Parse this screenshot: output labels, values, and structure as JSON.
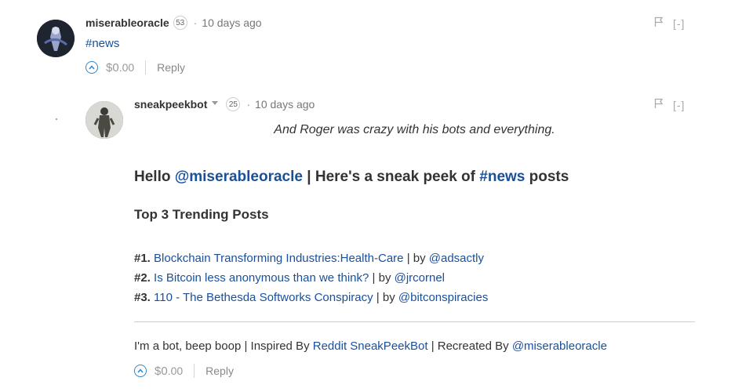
{
  "comment1": {
    "author": "miserableoracle",
    "reputation": "53",
    "time": "10 days ago",
    "body_tag": "#news",
    "payout_whole": "$0",
    "payout_decimal": ".00",
    "reply_label": "Reply",
    "collapse_label": "[-]",
    "icons": {
      "flag": "flag-icon",
      "vote": "upvote-icon"
    }
  },
  "comment2": {
    "author": "sneakpeekbot",
    "reputation": "25",
    "time": "10 days ago",
    "quote": "And Roger was crazy with his bots and everything.",
    "heading": {
      "hello": "Hello",
      "mention": "@miserableoracle",
      "middle": "| Here's a sneak peek of",
      "tag": "#news",
      "end": "posts"
    },
    "subheading": "Top 3 Trending Posts",
    "posts": [
      {
        "num": "#1.",
        "title": "Blockchain Transforming Industries:Health-Care",
        "by": "| by",
        "author": "@adsactly"
      },
      {
        "num": "#2.",
        "title": "Is Bitcoin less anonymous than we think?",
        "by": "| by",
        "author": "@jrcornel"
      },
      {
        "num": "#3.",
        "title": "110 - The Bethesda Softworks Conspiracy",
        "by": "| by",
        "author": "@bitconspiracies"
      }
    ],
    "signature": {
      "text1": "I'm a bot, beep boop | Inspired By",
      "link1": "Reddit SneakPeekBot",
      "text2": "| Recreated By",
      "link2": "@miserableoracle"
    },
    "payout_whole": "$0",
    "payout_decimal": ".00",
    "reply_label": "Reply",
    "collapse_label": "[-]",
    "icons": {
      "flag": "flag-icon",
      "vote": "upvote-icon",
      "dropdown": "chevron-down-icon"
    }
  },
  "colors": {
    "link": "#1a5099",
    "vote": "#2f86c8",
    "text": "#333333",
    "muted": "#999999"
  }
}
